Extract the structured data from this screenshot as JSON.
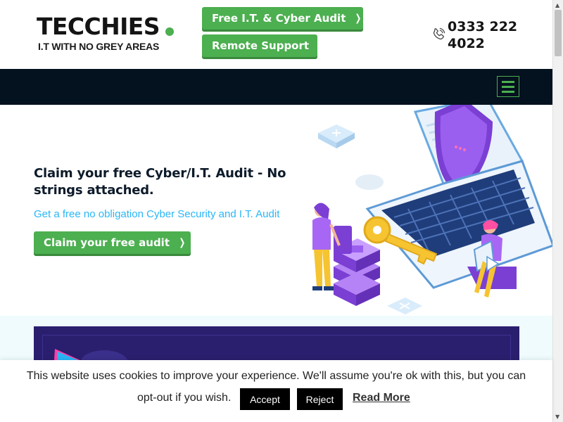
{
  "header": {
    "logo_word": "TECCHIES",
    "logo_tagline": "I.T WITH NO GREY AREAS",
    "audit_button": "Free I.T. & Cyber Audit",
    "remote_button": "Remote Support",
    "phone_number": "0333 222 4022",
    "brand_green": "#4caf50",
    "phone_icon": "phone-icon"
  },
  "nav": {
    "background": "#04111f",
    "menu_icon": "hamburger-icon"
  },
  "hero": {
    "title": "Claim your free Cyber/I.T. Audit - No strings attached.",
    "subtitle": "Get a free no obligation Cyber Security and I.T. Audit",
    "cta_button": "Claim your free audit",
    "subtitle_color": "#29b6f6"
  },
  "cookie_bar": {
    "line1": "This website uses cookies to improve your experience. We'll assume you're ok with this, but you can",
    "line2": "opt-out if you wish.",
    "accept": "Accept",
    "reject": "Reject",
    "read_more": "Read More"
  }
}
